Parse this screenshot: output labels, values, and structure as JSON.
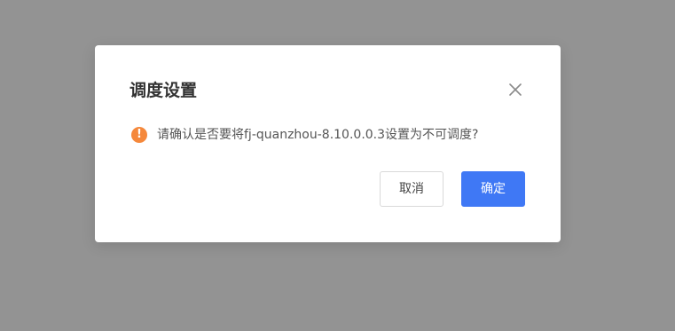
{
  "dialog": {
    "title": "调度设置",
    "close_icon": "close-icon",
    "message": {
      "icon": "warning-icon",
      "icon_glyph": "!",
      "icon_color": "#f5883b",
      "text": "请确认是否要将fj-quanzhou-8.10.0.0.3设置为不可调度?"
    },
    "buttons": {
      "cancel_label": "取消",
      "confirm_label": "确定"
    },
    "colors": {
      "primary": "#3f78f5",
      "overlay": "#939393"
    }
  }
}
